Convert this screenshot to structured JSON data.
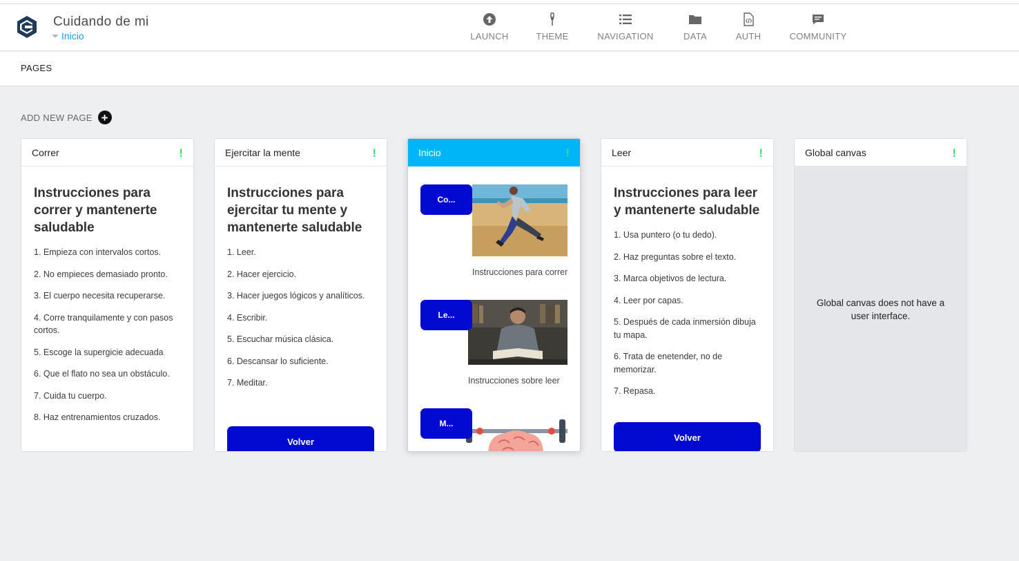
{
  "app": {
    "title": "Cuidando de mi",
    "current_page": "Inicio"
  },
  "nav": [
    {
      "label": "LAUNCH",
      "icon": "arrow-up-circle-icon"
    },
    {
      "label": "THEME",
      "icon": "brush-icon"
    },
    {
      "label": "NAVIGATION",
      "icon": "list-icon"
    },
    {
      "label": "DATA",
      "icon": "folder-icon"
    },
    {
      "label": "AUTH",
      "icon": "code-file-icon"
    },
    {
      "label": "COMMUNITY",
      "icon": "chat-icon"
    }
  ],
  "subbar": {
    "pages_label": "PAGES"
  },
  "add_page": {
    "label": "ADD NEW PAGE",
    "plus": "+"
  },
  "status_glyph": "!",
  "colors": {
    "accent": "#00b4f8",
    "button": "#0209d0",
    "status_ok": "#3ddc6e",
    "link": "#1aa0e8"
  },
  "cards": {
    "correr": {
      "title": "Correr",
      "heading": "Instrucciones para correr y mantenerte saludable",
      "items": [
        "1. Empieza con intervalos cortos.",
        "2. No empieces demasiado pronto.",
        "3. El cuerpo necesita recuperarse.",
        "4. Corre tranquilamente y con pasos cortos.",
        "5. Escoge la supergicie adecuada",
        "6. Que el flato no sea un obstáculo.",
        "7. Cuida tu cuerpo.",
        "8. Haz entrenamientos cruzados."
      ]
    },
    "mente": {
      "title": "Ejercitar la mente",
      "heading": "Instrucciones para ejercitar tu mente y mantenerte saludable",
      "items": [
        "1. Leer.",
        "2. Hacer ejercicio.",
        "3. Hacer juegos lógicos y analíticos.",
        "4. Escribir.",
        "5. Escuchar música clásica.",
        "6. Descansar lo suficiente.",
        "7. Meditar."
      ],
      "button": "Volver"
    },
    "inicio": {
      "title": "Inicio",
      "links": [
        {
          "pill": "Co...",
          "caption": "Instrucciones para correr"
        },
        {
          "pill": "Le...",
          "caption": "Instrucciones sobre leer"
        },
        {
          "pill": "M..."
        }
      ]
    },
    "leer": {
      "title": "Leer",
      "heading": "Instrucciones para leer y mantenerte saludable",
      "items": [
        "1. Usa puntero (o tu dedo).",
        "2. Haz preguntas sobre el texto.",
        "3. Marca objetivos de lectura.",
        "4. Leer por capas.",
        "5. Después de cada inmersión dibuja tu mapa.",
        "6. Trata de enetender, no de memorizar.",
        "7. Repasa."
      ],
      "button": "Volver"
    },
    "global": {
      "title": "Global canvas",
      "message": "Global canvas does not have a user interface."
    }
  }
}
